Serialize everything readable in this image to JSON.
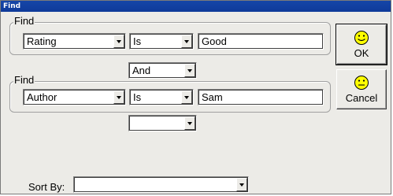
{
  "window": {
    "title": "Find"
  },
  "criteria1": {
    "legend": "Find",
    "field": "Rating",
    "operator": "Is",
    "value": "Good"
  },
  "connector1": "And",
  "criteria2": {
    "legend": "Find",
    "field": "Author",
    "operator": "Is",
    "value": "Sam"
  },
  "connector2": "",
  "sort": {
    "label": "Sort By:",
    "value": ""
  },
  "buttons": {
    "ok": {
      "label": "OK",
      "icon": "smiley-icon"
    },
    "cancel": {
      "label": "Cancel",
      "icon": "neutral-face-icon"
    }
  },
  "colors": {
    "title_bar": "#1546a8",
    "face_fill": "#ffff00",
    "dialog_bg": "#ecebe7"
  }
}
